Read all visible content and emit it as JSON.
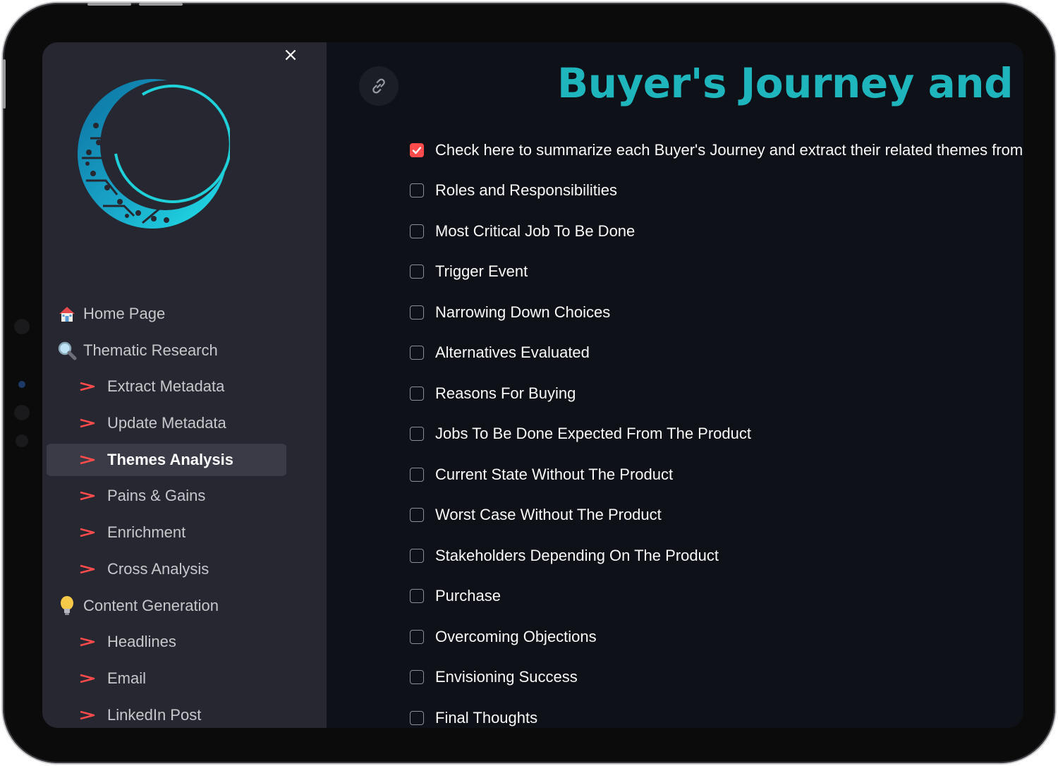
{
  "sidebar": {
    "close_label": "×",
    "logo_icon": "crescent-circuit-logo",
    "items": [
      {
        "label": "Home Page",
        "icon": "house-icon",
        "level": "top",
        "active": false
      },
      {
        "label": "Thematic Research",
        "icon": "magnifier-icon",
        "level": "top",
        "active": false
      },
      {
        "label": "Extract Metadata",
        "icon": "arrow-icon",
        "level": "sub",
        "active": false
      },
      {
        "label": "Update Metadata",
        "icon": "arrow-icon",
        "level": "sub",
        "active": false
      },
      {
        "label": "Themes Analysis",
        "icon": "arrow-icon",
        "level": "sub",
        "active": true
      },
      {
        "label": "Pains & Gains",
        "icon": "arrow-icon",
        "level": "sub",
        "active": false
      },
      {
        "label": "Enrichment",
        "icon": "arrow-icon",
        "level": "sub",
        "active": false
      },
      {
        "label": "Cross Analysis",
        "icon": "arrow-icon",
        "level": "sub",
        "active": false
      },
      {
        "label": "Content Generation",
        "icon": "lightbulb-icon",
        "level": "top",
        "active": false
      },
      {
        "label": "Headlines",
        "icon": "arrow-icon",
        "level": "sub",
        "active": false
      },
      {
        "label": "Email",
        "icon": "arrow-icon",
        "level": "sub",
        "active": false
      },
      {
        "label": "LinkedIn Post",
        "icon": "arrow-icon",
        "level": "sub",
        "active": false
      }
    ]
  },
  "main": {
    "link_icon": "link-icon",
    "title": "Buyer's Journey and Ass",
    "checkboxes": [
      {
        "label": "Check here to summarize each Buyer's Journey and extract their related themes from th",
        "checked": true
      },
      {
        "label": "Roles and Responsibilities",
        "checked": false
      },
      {
        "label": "Most Critical Job To Be Done",
        "checked": false
      },
      {
        "label": "Trigger Event",
        "checked": false
      },
      {
        "label": "Narrowing Down Choices",
        "checked": false
      },
      {
        "label": "Alternatives Evaluated",
        "checked": false
      },
      {
        "label": "Reasons For Buying",
        "checked": false
      },
      {
        "label": "Jobs To Be Done Expected From The Product",
        "checked": false
      },
      {
        "label": "Current State Without The Product",
        "checked": false
      },
      {
        "label": "Worst Case Without The Product",
        "checked": false
      },
      {
        "label": "Stakeholders Depending On The Product",
        "checked": false
      },
      {
        "label": "Purchase",
        "checked": false
      },
      {
        "label": "Overcoming Objections",
        "checked": false
      },
      {
        "label": "Envisioning Success",
        "checked": false
      },
      {
        "label": "Final Thoughts",
        "checked": false
      }
    ]
  },
  "colors": {
    "accent": "#1fb5bd",
    "checkbox_checked": "#ff4b4b",
    "sidebar_bg": "#262730",
    "main_bg": "#0e1117",
    "arrow": "#ff4b4b"
  }
}
